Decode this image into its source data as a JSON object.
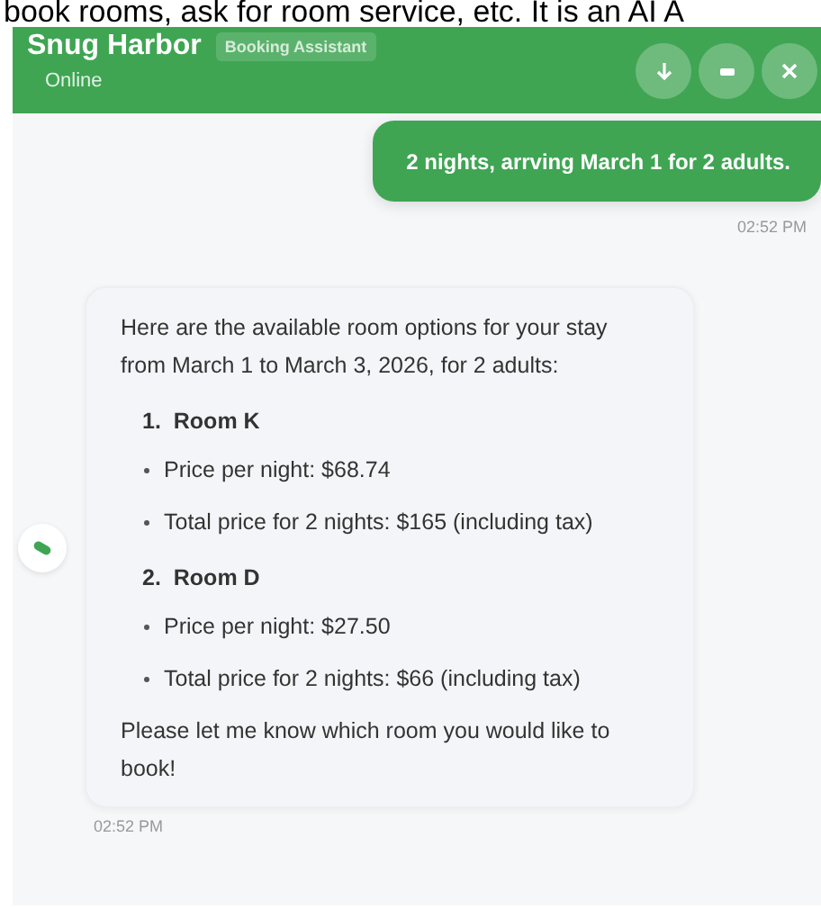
{
  "caption": "book rooms, ask for room service, etc. It is an AI A",
  "header": {
    "title": "Snug Harbor",
    "badge": "Booking Assistant",
    "status": "Online",
    "buttons": [
      {
        "kind": "download"
      },
      {
        "kind": "minimize"
      },
      {
        "kind": "close"
      }
    ]
  },
  "messages": [
    {
      "kind": "user",
      "text": "2 nights, arrving March 1 for 2 adults.",
      "time": "02:52 PM"
    },
    {
      "kind": "bot",
      "intro": "Here are the available room options for your stay from March 1 to March 3, 2026, for 2 adults:",
      "options": [
        {
          "number": "1.",
          "title": "Room K",
          "details": [
            "Price per night: $68.74",
            "Total price for 2 nights: $165 (including tax)"
          ]
        },
        {
          "number": "2.",
          "title": "Room D",
          "details": [
            "Price per night: $27.50",
            "Total price for 2 nights: $66 (including tax)"
          ]
        }
      ],
      "closing": "Please let me know which room you would like to book!",
      "time": "02:52 PM"
    }
  ]
}
